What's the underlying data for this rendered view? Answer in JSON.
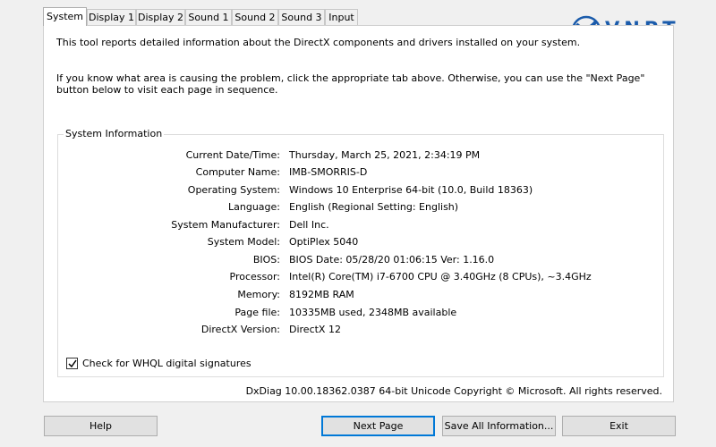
{
  "tabs": [
    {
      "label": "System"
    },
    {
      "label": "Display 1"
    },
    {
      "label": "Display 2"
    },
    {
      "label": "Sound 1"
    },
    {
      "label": "Sound 2"
    },
    {
      "label": "Sound 3"
    },
    {
      "label": "Input"
    }
  ],
  "active_tab": "System",
  "intro": {
    "line1": "This tool reports detailed information about the DirectX components and drivers installed on your system.",
    "line2": "If you know what area is causing the problem, click the appropriate tab above.  Otherwise, you can use the \"Next Page\" button below to visit each page in sequence."
  },
  "system_info": {
    "legend": "System Information",
    "rows": [
      {
        "label": "Current Date/Time:",
        "value": "Thursday, March 25, 2021, 2:34:19 PM"
      },
      {
        "label": "Computer Name:",
        "value": "IMB-SMORRIS-D"
      },
      {
        "label": "Operating System:",
        "value": "Windows 10 Enterprise 64-bit (10.0, Build 18363)"
      },
      {
        "label": "Language:",
        "value": "English (Regional Setting: English)"
      },
      {
        "label": "System Manufacturer:",
        "value": "Dell Inc."
      },
      {
        "label": "System Model:",
        "value": "OptiPlex 5040"
      },
      {
        "label": "BIOS:",
        "value": "BIOS Date: 05/28/20 01:06:15 Ver: 1.16.0"
      },
      {
        "label": "Processor:",
        "value": "Intel(R) Core(TM) i7-6700 CPU @ 3.40GHz (8 CPUs), ~3.4GHz"
      },
      {
        "label": "Memory:",
        "value": "8192MB RAM"
      },
      {
        "label": "Page file:",
        "value": "10335MB used, 2348MB available"
      },
      {
        "label": "DirectX Version:",
        "value": "DirectX 12"
      }
    ]
  },
  "whql_checkbox": {
    "label": "Check for WHQL digital signatures",
    "checked": true
  },
  "footer": "DxDiag 10.00.18362.0387 64-bit Unicode  Copyright © Microsoft. All rights reserved.",
  "buttons": {
    "help": "Help",
    "next_page": "Next Page",
    "save_all": "Save All Information...",
    "exit": "Exit"
  },
  "logo": {
    "text": "VNPT",
    "color": "#1a5bab"
  },
  "colors": {
    "accent": "#0078d7",
    "logo": "#1a5bab"
  }
}
